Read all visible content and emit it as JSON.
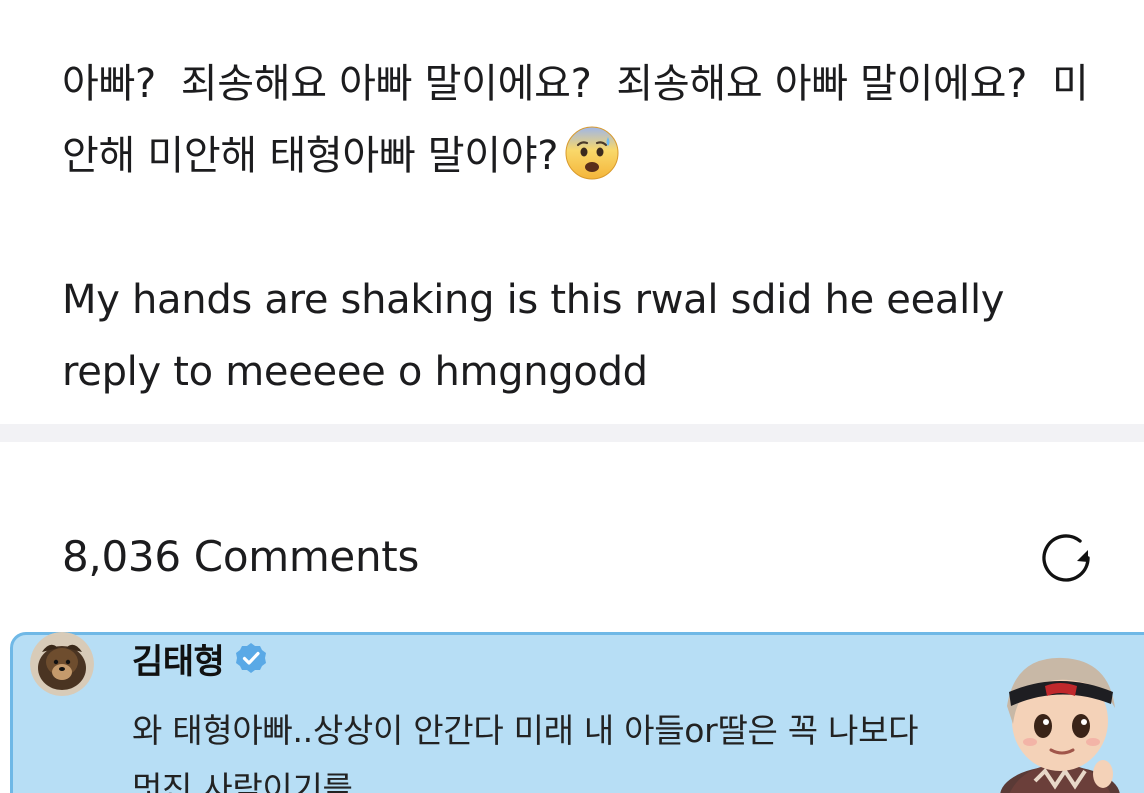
{
  "post": {
    "korean_text": "아빠?  죄송해요 아빠 말이에요?  죄송해요 아빠 말이에요?  미안해 미안해 태형아빠 말이야?",
    "emoji": "anxious-face-with-sweat",
    "english_text": "My hands are shaking is this rwal sdid he eeally reply to meeeee o hmgngodd"
  },
  "comments": {
    "count_label": "8,036 Comments",
    "refresh_icon": "refresh-icon"
  },
  "pinned_comment": {
    "author": "김태형",
    "verified_icon": "verified-badge-icon",
    "text": "와 태형아빠..상상이 안간다 미래 내 아들or딸은 꼭 나보다 멋진 사람이기를",
    "highlight_color": "#b7def5",
    "border_color": "#6fb8e6",
    "verified_color": "#5aa9e6"
  },
  "colors": {
    "divider": "#f2f2f5",
    "text": "#1c1c1e"
  }
}
